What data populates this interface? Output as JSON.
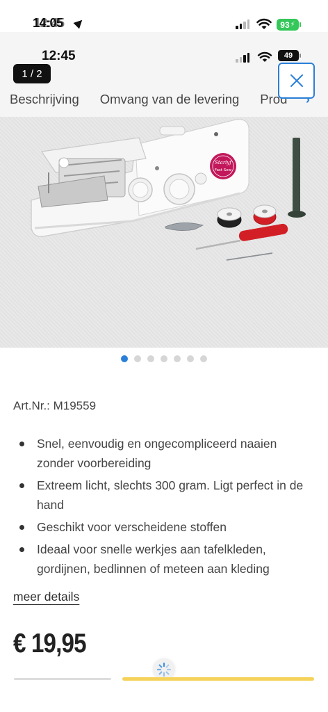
{
  "outer_status": {
    "time": "14:05",
    "time_ghost": "12:45",
    "battery": "93"
  },
  "inner_status": {
    "time": "12:45",
    "battery": "49"
  },
  "gallery": {
    "counter": "1 / 2",
    "dot_count": 7,
    "active_dot": 0
  },
  "tabs": [
    "Beschrijving",
    "Omvang van de levering",
    "Prod"
  ],
  "product": {
    "article_number": "Art.Nr.: M19559",
    "features": [
      "Snel, eenvoudig en ongecompliceerd naaien zonder voorbereiding",
      "Extreem licht, slechts 300 gram. Ligt perfect in de hand",
      "Geschikt voor verscheidene stoffen",
      "Ideaal voor snelle werkjes aan tafelkleden, gordijnen, bedlinnen of meteen aan kleding"
    ],
    "more_details": "meer details",
    "price": "€ 19,95",
    "badge_text": "Starlyf Fast Sew"
  },
  "colors": {
    "accent": "#2a7fd8",
    "battery_green": "#34c759",
    "spool_red": "#d21f26",
    "badge": "#c2185b"
  },
  "icons": [
    "location-arrow-icon",
    "signal-icon",
    "wifi-icon",
    "battery-icon",
    "close-icon",
    "chevron-right-icon",
    "loading-spinner-icon"
  ]
}
